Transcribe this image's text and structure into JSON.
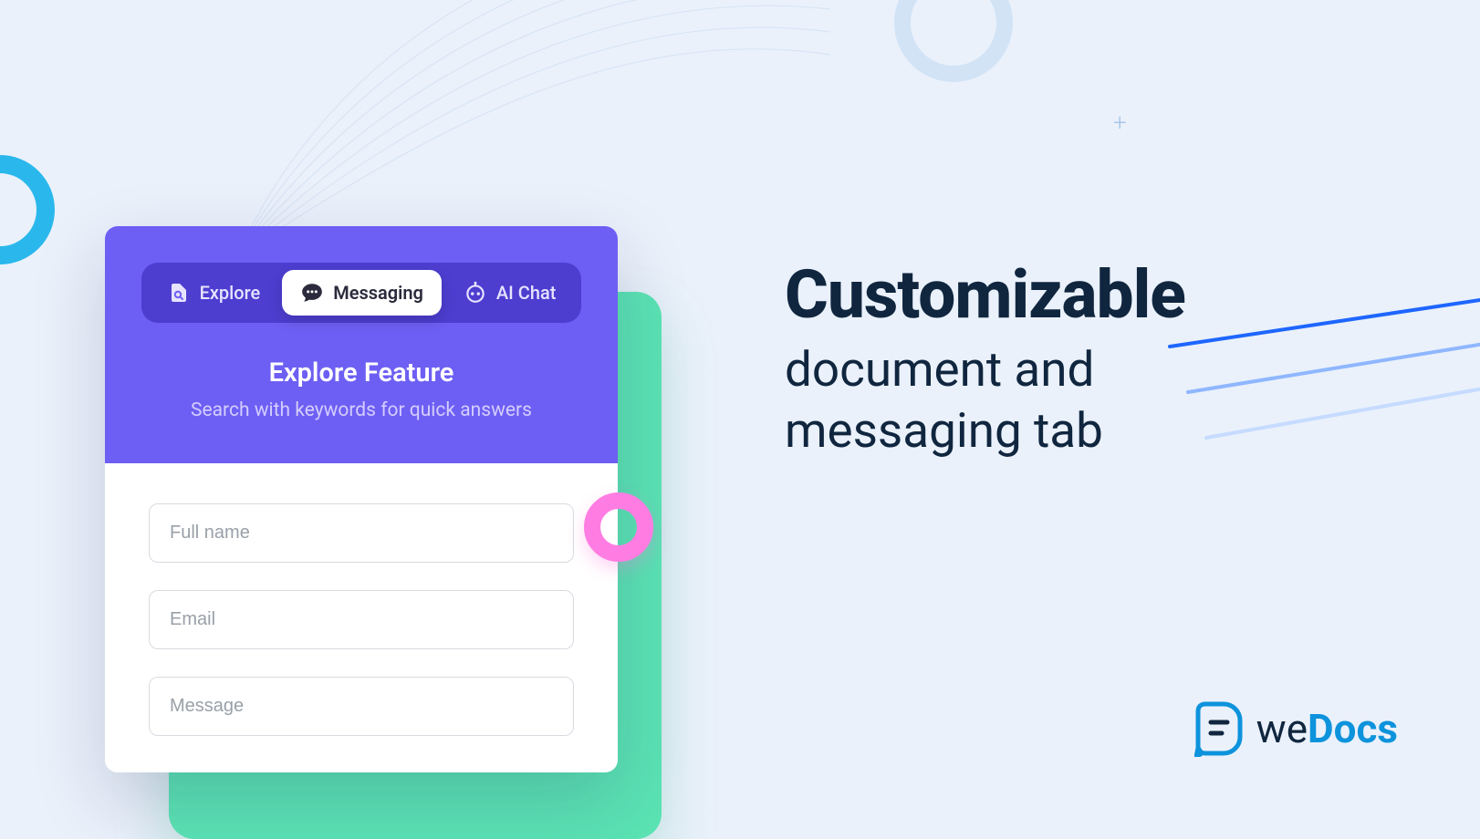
{
  "tabs": {
    "explore": "Explore",
    "messaging": "Messaging",
    "ai_chat": "AI Chat"
  },
  "widget": {
    "title": "Explore Feature",
    "subtitle": "Search with keywords for quick answers"
  },
  "form": {
    "full_name_placeholder": "Full name",
    "email_placeholder": "Email",
    "message_placeholder": "Message"
  },
  "headline": {
    "bold": "Customizable",
    "line2": "document and",
    "line3": "messaging tab"
  },
  "brand": {
    "prefix": "we",
    "suffix": "Docs"
  }
}
